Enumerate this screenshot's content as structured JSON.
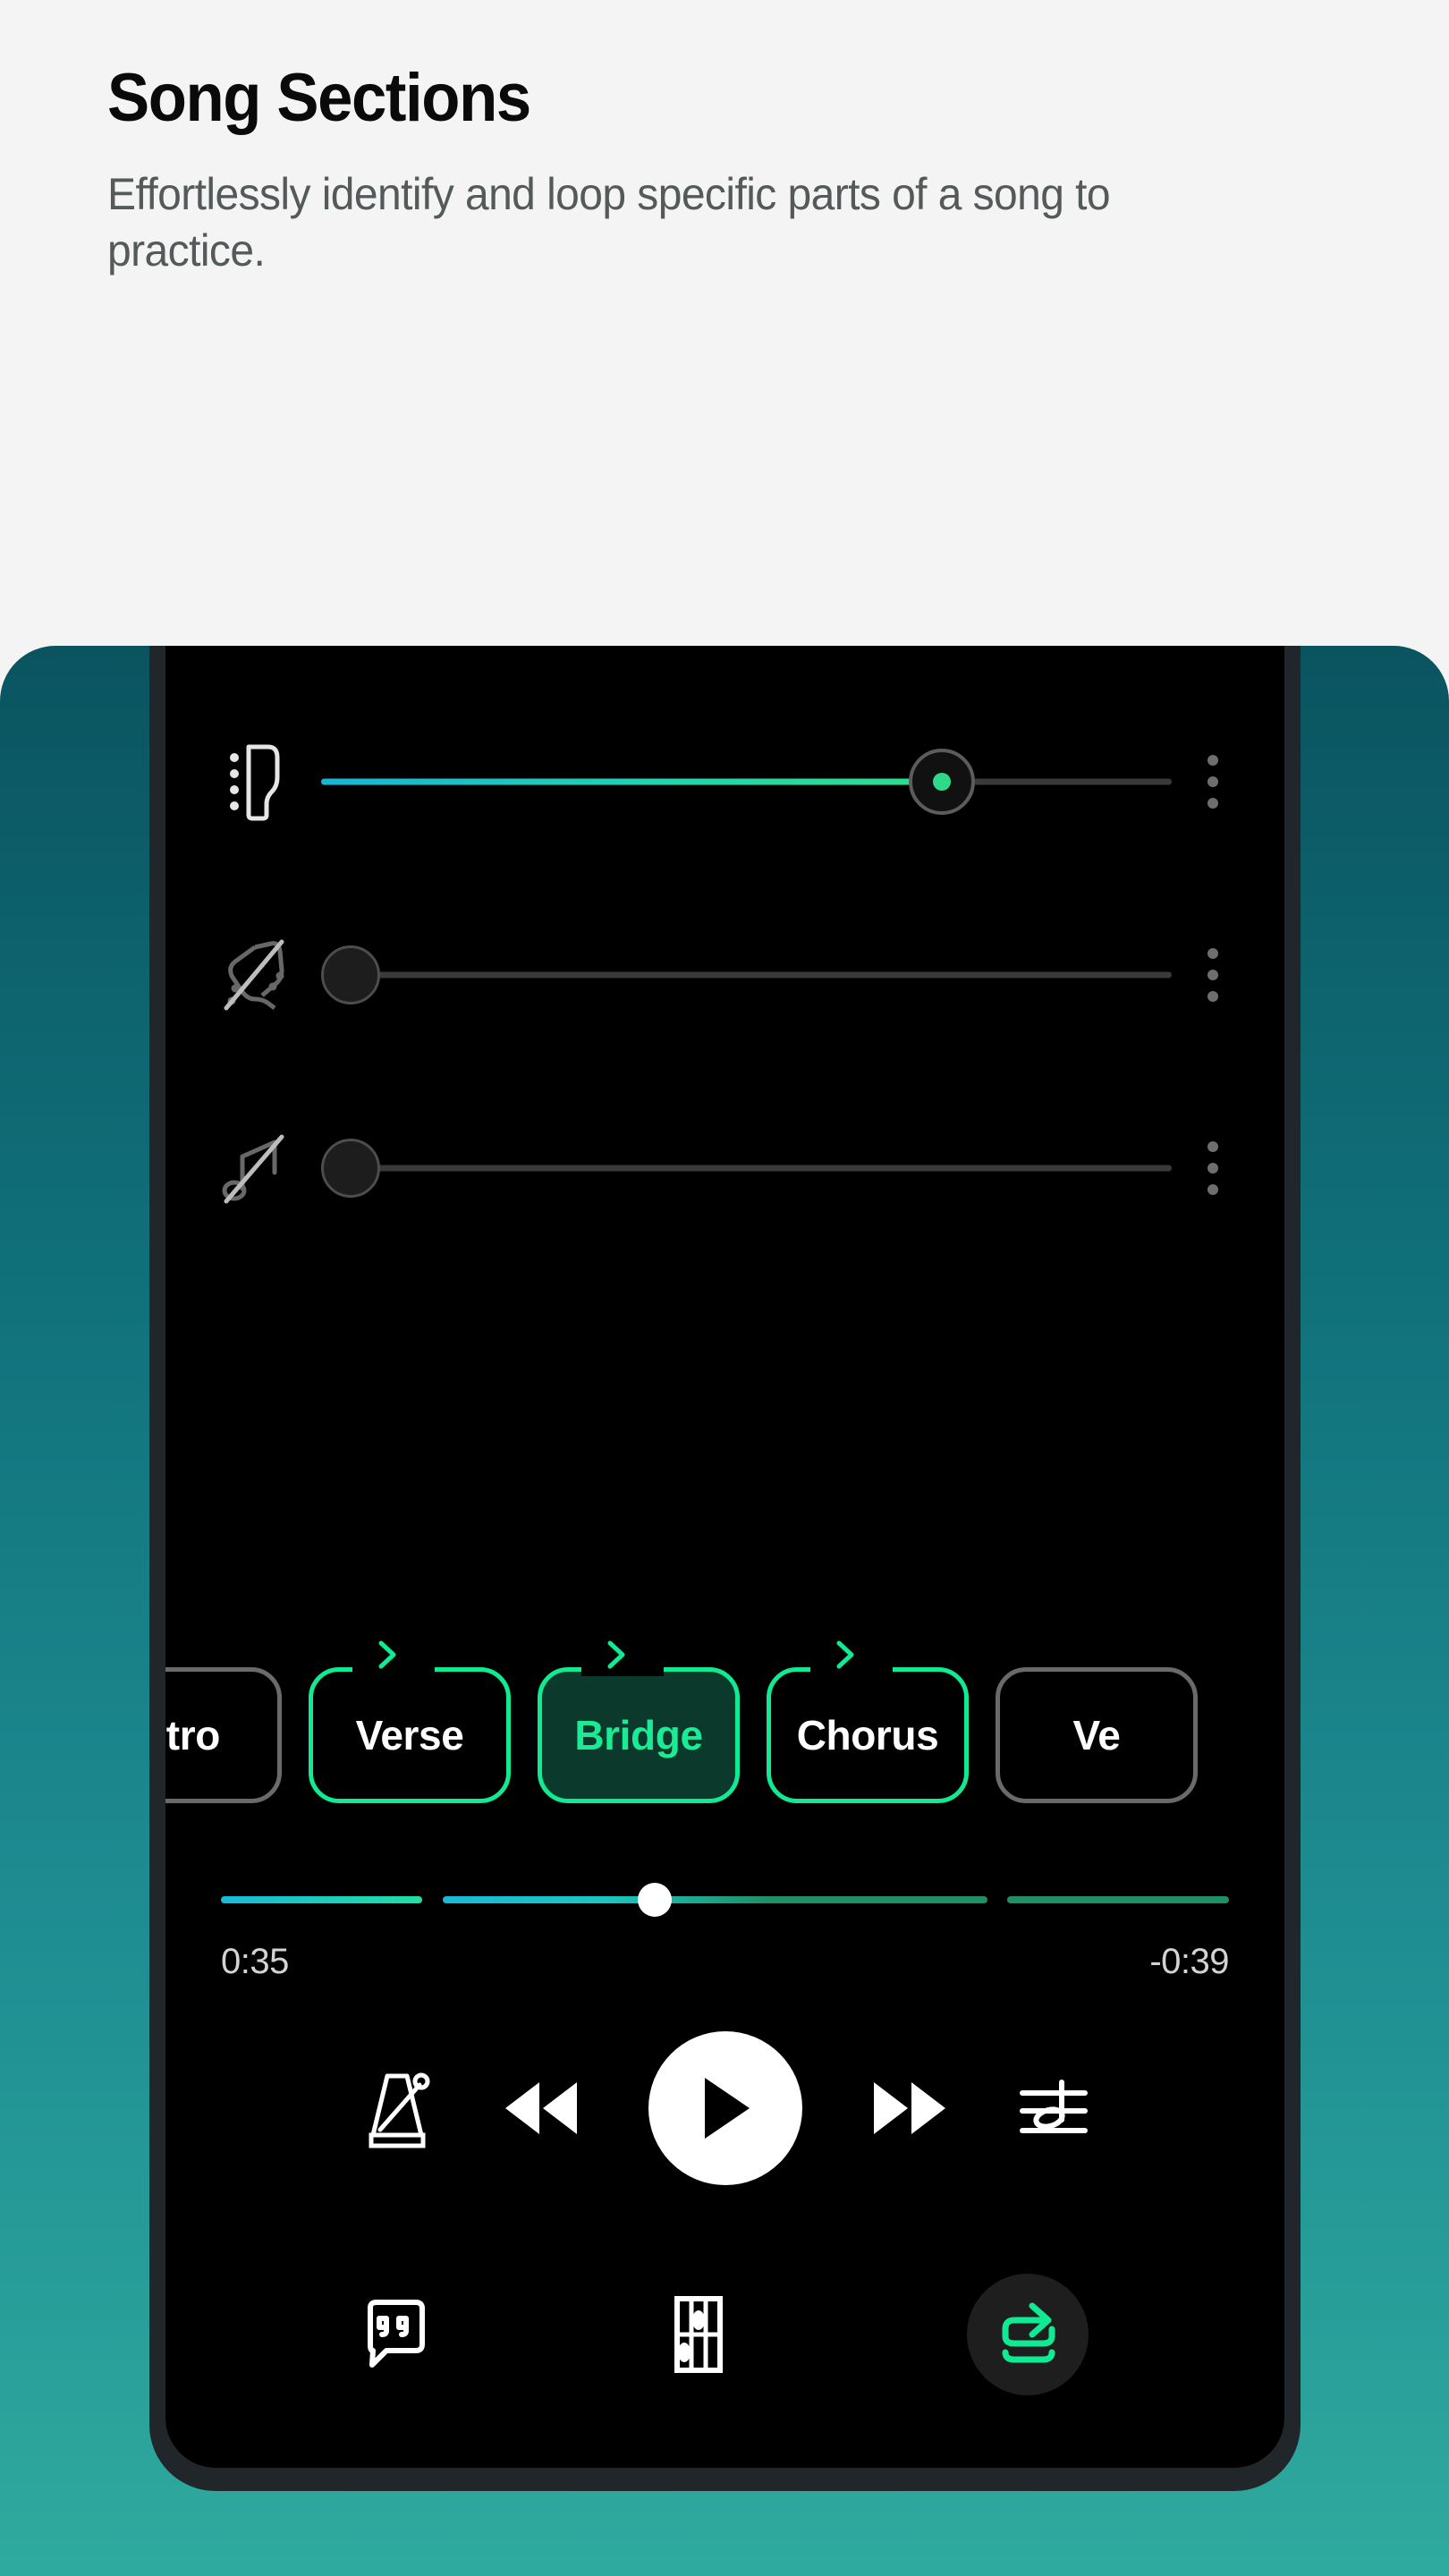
{
  "header": {
    "title": "Song Sections",
    "subtitle": "Effortlessly identify and loop specific parts of a song to practice."
  },
  "colors": {
    "accent_green": "#0fea93",
    "accent_teal": "#17b5d6",
    "panel_top": "#0a5460",
    "panel_bottom": "#2faa9e",
    "screen_bg": "#000000",
    "chip_selected_fill": "#0b3a2c",
    "muted_gray": "#6a6a6a"
  },
  "phone": {
    "mixer": {
      "tracks": [
        {
          "icon": "guitar-headstock-icon",
          "muted": false,
          "value_percent": 73,
          "menu_icon": "overflow-menu-icon"
        },
        {
          "icon": "guitar-headstock-muted-icon",
          "muted": true,
          "value_percent": 0,
          "menu_icon": "overflow-menu-icon"
        },
        {
          "icon": "music-note-muted-icon",
          "muted": true,
          "value_percent": 0,
          "menu_icon": "overflow-menu-icon"
        }
      ]
    },
    "sections": {
      "chips": [
        {
          "label": "ntro",
          "state": "clipped-left",
          "loop": false,
          "selected": false
        },
        {
          "label": "Verse",
          "state": "normal",
          "loop": true,
          "selected": false
        },
        {
          "label": "Bridge",
          "state": "normal",
          "loop": true,
          "selected": true
        },
        {
          "label": "Chorus",
          "state": "normal",
          "loop": true,
          "selected": false
        },
        {
          "label": "Ve",
          "state": "clipped-right",
          "loop": false,
          "selected": false
        }
      ]
    },
    "progress": {
      "elapsed": "0:35",
      "remaining": "-0:39",
      "position_percent": 43,
      "segments": [
        {
          "start_percent": 0,
          "end_percent": 20
        },
        {
          "start_percent": 22,
          "end_percent": 76
        },
        {
          "start_percent": 78,
          "end_percent": 100
        }
      ]
    },
    "transport": {
      "metronome_label": "metronome-icon",
      "rewind_label": "rewind-icon",
      "play_label": "play-icon",
      "forward_label": "fast-forward-icon",
      "pitch_label": "pitch-notation-icon"
    },
    "bottom_bar": {
      "lyrics_label": "lyrics-icon",
      "chords_label": "chord-diagram-icon",
      "loop_label": "loop-icon"
    }
  }
}
